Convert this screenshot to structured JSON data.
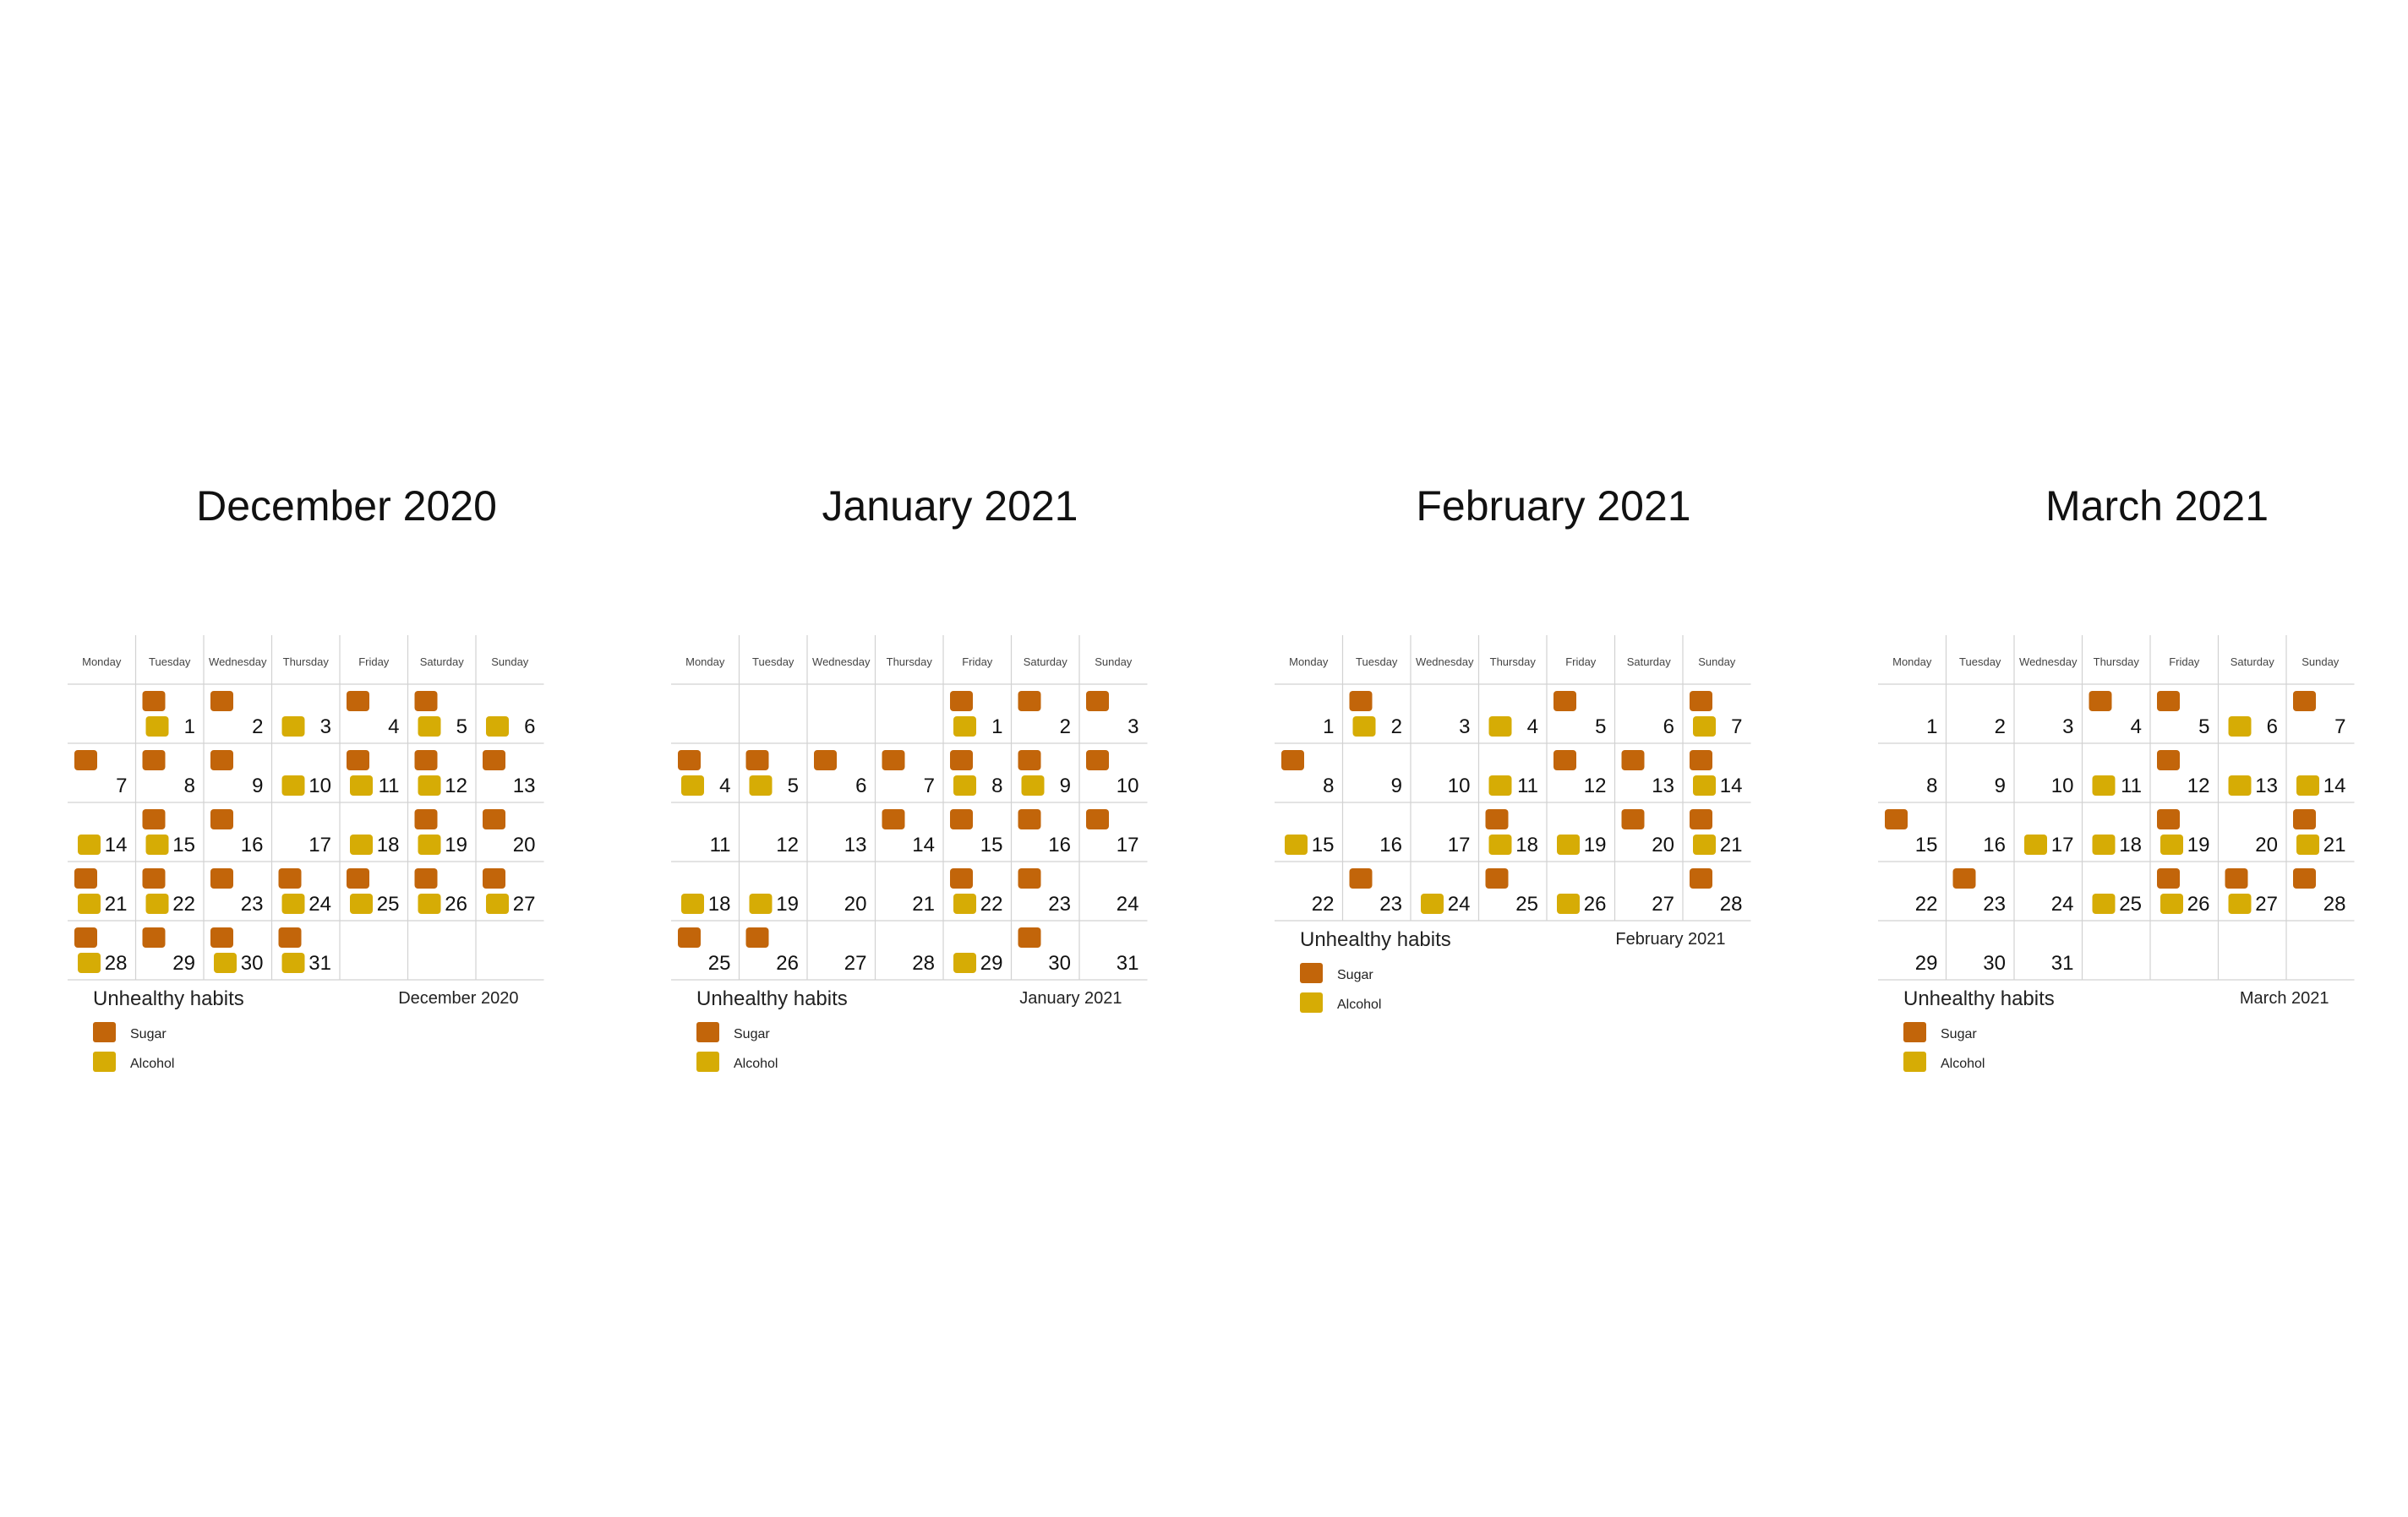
{
  "colors": {
    "sugar": "#C2650A",
    "alcohol": "#D6AC05",
    "grid": "#d2d2d2",
    "text": "#111111"
  },
  "weekdays": [
    "Monday",
    "Tuesday",
    "Wednesday",
    "Thursday",
    "Friday",
    "Saturday",
    "Sunday"
  ],
  "legend": {
    "title": "Unhealthy habits",
    "items": [
      "Sugar",
      "Alcohol"
    ]
  },
  "chart_data": [
    {
      "type": "calendar",
      "title": "December 2020",
      "caption": "December 2020",
      "first_weekday": 1,
      "days_in_month": 31,
      "legend_placement": "bottom-left",
      "series": [
        {
          "name": "Sugar",
          "days": [
            1,
            2,
            4,
            5,
            7,
            8,
            9,
            11,
            12,
            13,
            15,
            16,
            19,
            20,
            21,
            22,
            23,
            24,
            25,
            26,
            27,
            28,
            29,
            30,
            31
          ]
        },
        {
          "name": "Alcohol",
          "days": [
            1,
            3,
            5,
            6,
            10,
            11,
            12,
            14,
            15,
            18,
            19,
            21,
            22,
            24,
            25,
            26,
            27,
            28,
            30,
            31
          ]
        }
      ]
    },
    {
      "type": "calendar",
      "title": "January 2021",
      "caption": "January 2021",
      "first_weekday": 4,
      "days_in_month": 31,
      "legend_placement": "bottom-left",
      "series": [
        {
          "name": "Sugar",
          "days": [
            1,
            2,
            3,
            4,
            5,
            6,
            7,
            8,
            9,
            10,
            14,
            15,
            16,
            17,
            22,
            23,
            25,
            26,
            30
          ]
        },
        {
          "name": "Alcohol",
          "days": [
            1,
            4,
            5,
            8,
            9,
            18,
            19,
            22,
            29
          ]
        }
      ]
    },
    {
      "type": "calendar",
      "title": "February 2021",
      "caption": "February 2021",
      "first_weekday": 0,
      "days_in_month": 28,
      "legend_placement": "bottom-left",
      "series": [
        {
          "name": "Sugar",
          "days": [
            2,
            5,
            7,
            8,
            12,
            13,
            14,
            18,
            20,
            21,
            23,
            25,
            28
          ]
        },
        {
          "name": "Alcohol",
          "days": [
            2,
            4,
            7,
            11,
            14,
            15,
            18,
            19,
            21,
            24,
            26
          ]
        }
      ]
    },
    {
      "type": "calendar",
      "title": "March 2021",
      "caption": "March 2021",
      "first_weekday": 0,
      "days_in_month": 31,
      "legend_placement": "bottom-left",
      "series": [
        {
          "name": "Sugar",
          "days": [
            4,
            5,
            7,
            12,
            15,
            19,
            21,
            23,
            26,
            27,
            28
          ]
        },
        {
          "name": "Alcohol",
          "days": [
            6,
            11,
            13,
            14,
            17,
            18,
            19,
            21,
            25,
            26,
            27
          ]
        }
      ]
    }
  ]
}
